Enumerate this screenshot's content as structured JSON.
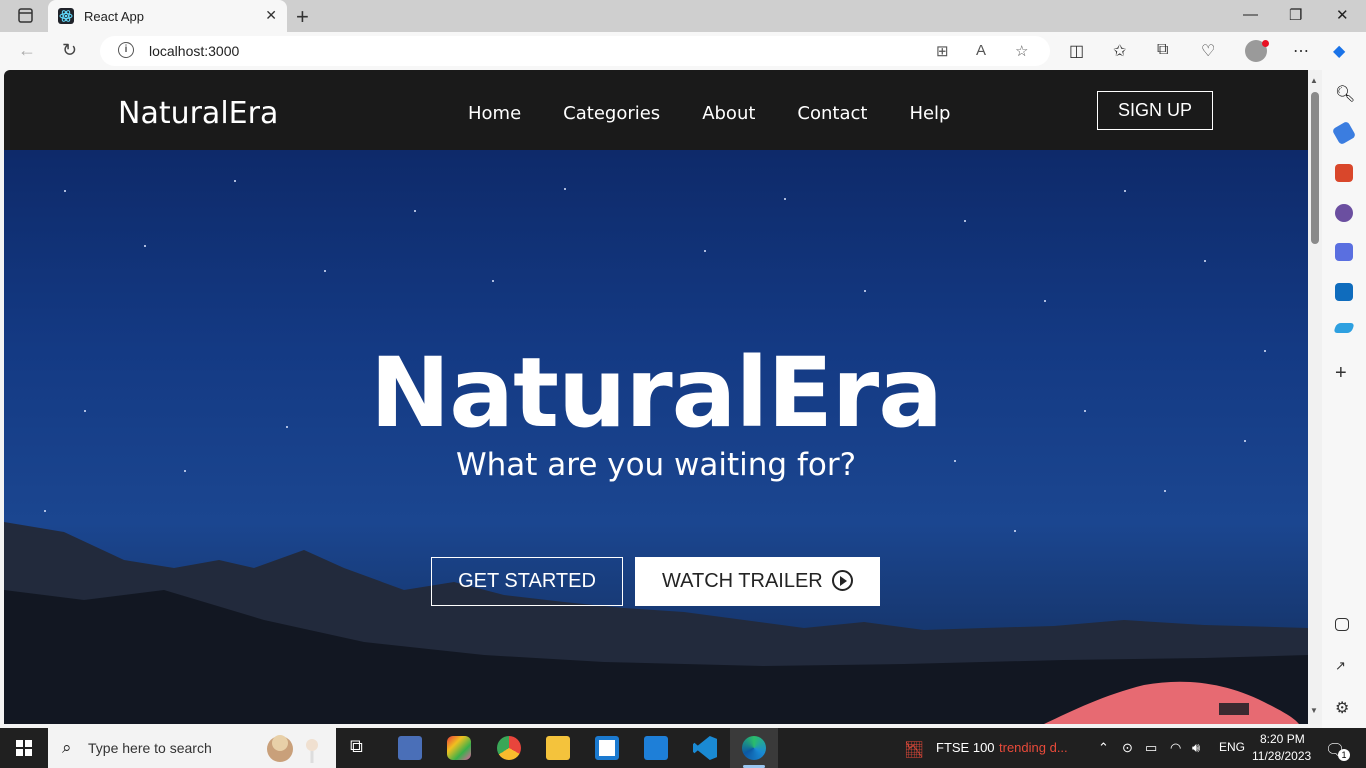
{
  "browser": {
    "tab_title": "React App",
    "url": "localhost:3000",
    "tab_close": "✕",
    "new_tab": "+",
    "window_controls": [
      "—",
      "❐",
      "✕"
    ]
  },
  "site": {
    "brand": "NaturalEra",
    "nav": [
      "Home",
      "Categories",
      "About",
      "Contact",
      "Help"
    ],
    "signup_label": "SIGN UP",
    "hero": {
      "title": "NaturalEra",
      "subtitle": "What are you waiting for?",
      "primary_button": "GET STARTED",
      "secondary_button": "WATCH TRAILER"
    }
  },
  "taskbar": {
    "search_placeholder": "Type here to search",
    "stock_name": "FTSE 100",
    "stock_status": "trending d...",
    "language": "ENG",
    "time": "8:20 PM",
    "date": "11/28/2023",
    "notification_count": "1"
  },
  "colors": {
    "navbar_bg": "#1a1a1a",
    "hero_sky": "#143a84",
    "stock_accent": "#e84a3a"
  }
}
